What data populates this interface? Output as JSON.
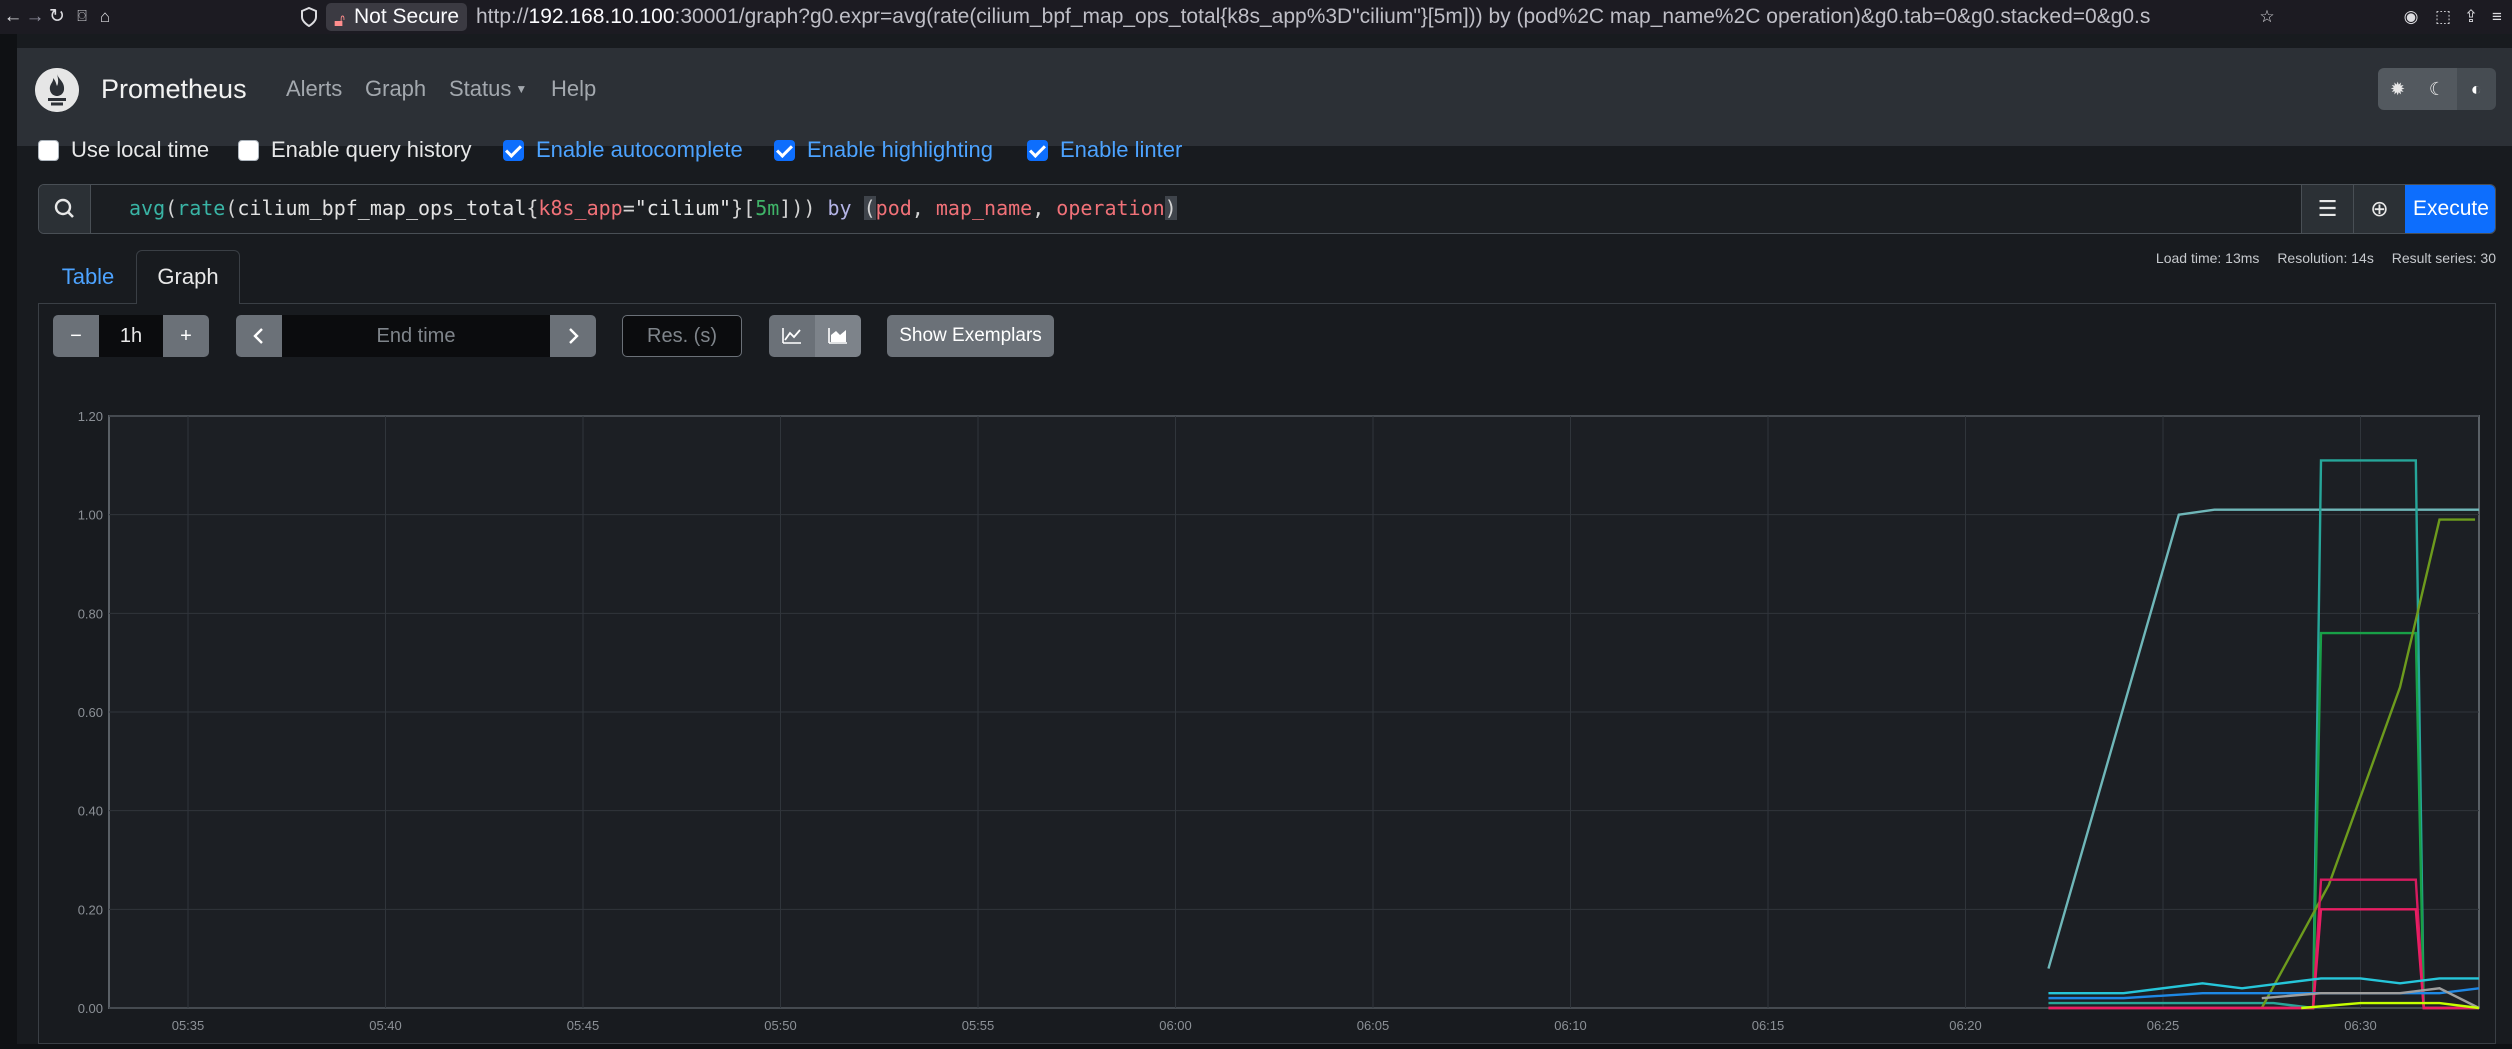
{
  "browser": {
    "url_prefix": "http://",
    "url_host": "192.168.10.100",
    "url_rest": ":30001/graph?g0.expr=avg(rate(cilium_bpf_map_ops_total{k8s_app%3D\"cilium\"}[5m])) by (pod%2C map_name%2C operation)&g0.tab=0&g0.stacked=0&g0.s",
    "security_label": "Not Secure"
  },
  "navbar": {
    "brand": "Prometheus",
    "links": [
      "Alerts",
      "Graph",
      "Status",
      "Help"
    ]
  },
  "options": [
    {
      "label": "Use local time",
      "checked": false
    },
    {
      "label": "Enable query history",
      "checked": false
    },
    {
      "label": "Enable autocomplete",
      "checked": true
    },
    {
      "label": "Enable highlighting",
      "checked": true
    },
    {
      "label": "Enable linter",
      "checked": true
    }
  ],
  "expression": "avg(rate(cilium_bpf_map_ops_total{k8s_app=\"cilium\"}[5m])) by (pod, map_name, operation)",
  "execute_label": "Execute",
  "tabs": [
    "Table",
    "Graph"
  ],
  "active_tab": "Graph",
  "stats": {
    "load_time": "Load time: 13ms",
    "resolution": "Resolution: 14s",
    "result_series": "Result series: 30"
  },
  "controls": {
    "range": "1h",
    "minus": "−",
    "plus": "+",
    "end_time_placeholder": "End time",
    "resolution_placeholder": "Res. (s)",
    "show_exemplars": "Show Exemplars",
    "stacked": false
  },
  "chart_data": {
    "type": "line",
    "y_ticks": [
      "0.00",
      "0.20",
      "0.40",
      "0.60",
      "0.80",
      "1.00",
      "1.20"
    ],
    "x_ticks": [
      "05:35",
      "05:40",
      "05:45",
      "05:50",
      "05:55",
      "06:00",
      "06:05",
      "06:10",
      "06:15",
      "06:20",
      "06:25",
      "06:30"
    ],
    "ylim": [
      0,
      1.2
    ],
    "x_unit": "minutes after 05:33",
    "xlim": [
      0,
      60
    ],
    "grid": true,
    "series": [
      {
        "color": "#6fb7b9",
        "x": [
          49.1,
          52.4,
          53.3,
          60
        ],
        "y": [
          0.08,
          1.0,
          1.01,
          1.01
        ]
      },
      {
        "color": "#26a69a",
        "x": [
          49.1,
          54.8,
          55.8,
          56.0,
          58.4,
          58.6,
          60
        ],
        "y": [
          0.01,
          0.01,
          0.0,
          1.11,
          1.11,
          0.0,
          0.0
        ]
      },
      {
        "color": "#18a047",
        "x": [
          49.1,
          54.8,
          55.8,
          56.0,
          58.4,
          58.6,
          60
        ],
        "y": [
          0.0,
          0.0,
          0.0,
          0.76,
          0.76,
          0.0,
          0.0
        ]
      },
      {
        "color": "#6d9b1d",
        "x": [
          54.5,
          56.2,
          58.0,
          59.0,
          59.9
        ],
        "y": [
          0.0,
          0.25,
          0.65,
          0.99,
          0.99
        ]
      },
      {
        "color": "#d81b60",
        "x": [
          49.1,
          55.8,
          56.0,
          58.4,
          58.6,
          60
        ],
        "y": [
          0.0,
          0.0,
          0.26,
          0.26,
          0.0,
          0.0
        ]
      },
      {
        "color": "#e91e63",
        "x": [
          49.1,
          55.8,
          56.0,
          58.4,
          58.6,
          60
        ],
        "y": [
          0.0,
          0.0,
          0.2,
          0.2,
          0.0,
          0.0
        ]
      },
      {
        "color": "#26c6da",
        "x": [
          49.1,
          51.0,
          53.0,
          54.0,
          55.0,
          56.0,
          57.0,
          58.0,
          59.0,
          60
        ],
        "y": [
          0.03,
          0.03,
          0.05,
          0.04,
          0.05,
          0.06,
          0.06,
          0.05,
          0.06,
          0.06
        ]
      },
      {
        "color": "#1e88e5",
        "x": [
          49.1,
          51.0,
          53.0,
          55.0,
          57.0,
          59.0,
          60
        ],
        "y": [
          0.02,
          0.02,
          0.03,
          0.03,
          0.03,
          0.03,
          0.04
        ]
      },
      {
        "color": "#9e9e9e",
        "x": [
          54.5,
          56.0,
          58.0,
          59.0,
          60
        ],
        "y": [
          0.02,
          0.03,
          0.03,
          0.04,
          0.0
        ]
      },
      {
        "color": "#c6ff00",
        "x": [
          55.5,
          57.0,
          59.0,
          60
        ],
        "y": [
          0.0,
          0.01,
          0.01,
          0.0
        ]
      }
    ]
  }
}
